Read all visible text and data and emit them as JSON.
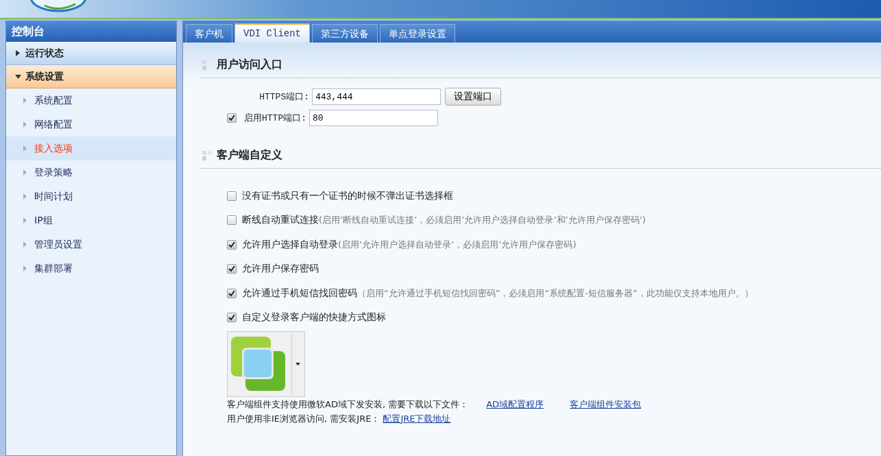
{
  "sidebar": {
    "title": "控制台",
    "groups": [
      {
        "label": "运行状态",
        "expanded": false
      },
      {
        "label": "系统设置",
        "expanded": true,
        "children": [
          {
            "label": "系统配置",
            "selected": false
          },
          {
            "label": "网络配置",
            "selected": false
          },
          {
            "label": "接入选项",
            "selected": true
          },
          {
            "label": "登录策略",
            "selected": false
          },
          {
            "label": "时间计划",
            "selected": false
          },
          {
            "label": "IP组",
            "selected": false
          },
          {
            "label": "管理员设置",
            "selected": false
          },
          {
            "label": "集群部署",
            "selected": false
          }
        ]
      }
    ]
  },
  "tabs": [
    {
      "label": "客户机",
      "selected": false
    },
    {
      "label": "VDI Client",
      "selected": true
    },
    {
      "label": "第三方设备",
      "selected": false
    },
    {
      "label": "单点登录设置",
      "selected": false
    }
  ],
  "access": {
    "title": "用户访问入口",
    "https_label": "HTTPS端口:",
    "https_value": "443,444",
    "button": "设置端口",
    "http_label": "启用HTTP端口:",
    "http_checked": true,
    "http_value": "80"
  },
  "client": {
    "title": "客户端自定义",
    "options": [
      {
        "label": "没有证书或只有一个证书的时候不弹出证书选择框",
        "checked": false
      },
      {
        "label": "断线自动重试连接",
        "note": "(启用’断线自动重试连接’，必须启用’允许用户选择自动登录’和’允许用户保存密码’)",
        "checked": false
      },
      {
        "label": "允许用户选择自动登录",
        "note": "(启用’允许用户选择自动登录’，必须启用’允许用户保存密码)",
        "checked": true
      },
      {
        "label": "允许用户保存密码",
        "checked": true
      },
      {
        "label": "允许通过手机短信找回密码",
        "note": "（启用“允许通过手机短信找回密码”，必须启用“系统配置-短信服务器”，此功能仅支持本地用户。）",
        "checked": true
      },
      {
        "label": "自定义登录客户端的快捷方式图标",
        "checked": true
      }
    ],
    "lines": [
      {
        "text": "客户端组件支持使用微软AD域下发安装, 需要下载以下文件：",
        "links": [
          "AD域配置程序",
          "客户端组件安装包"
        ]
      },
      {
        "text": "用户使用非IE浏览器访问, 需安装JRE：",
        "links": [
          "配置JRE下载地址"
        ]
      }
    ]
  }
}
